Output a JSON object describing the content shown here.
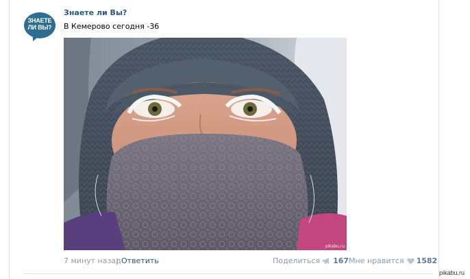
{
  "post": {
    "author": "Знаете ли Вы?",
    "avatar_text_line1": "ЗНАЕТЕ",
    "avatar_text_line2": "ЛИ ВЫ?",
    "text": "В Кемерово сегодня -36",
    "photo_description": "photo-girl-frosted-eyelashes-scarf",
    "photo_watermark": "pikabu.ru"
  },
  "footer": {
    "time": "7 минут назад",
    "separator": "|",
    "reply": "Ответить",
    "share_label": "Поделиться",
    "share_count": "167",
    "like_label": "Мне нравится",
    "like_count": "1582"
  },
  "site_watermark": "pikabu.ru",
  "colors": {
    "link": "#2b587a",
    "muted": "#999999",
    "avatar_bg": "#2e6d8f",
    "count": "#5b7a97"
  },
  "icons": {
    "share": "megaphone-icon",
    "like": "heart-icon"
  }
}
